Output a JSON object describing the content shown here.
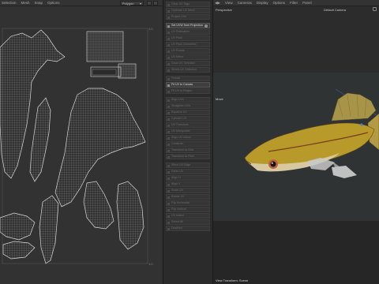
{
  "uv_editor": {
    "menu": [
      "Selection",
      "Mesh",
      "Snap",
      "Options"
    ],
    "mode_select": "Polygon",
    "axis_labels": {
      "top_right": "1.0",
      "bottom_right": "1.0"
    }
  },
  "command_panel": {
    "items": [
      {
        "label": "Clear UV Tags",
        "active": false
      },
      {
        "label": "Optimize UV Mesh",
        "active": false
      },
      {
        "label": "Project UVs",
        "active": false
      },
      {
        "label": "Set UVW from Projection",
        "active": true,
        "dot": true
      },
      {
        "label": "UV Relaxation",
        "active": false
      },
      {
        "label": "UV Pack",
        "active": false
      },
      {
        "label": "UV Pack Geometric",
        "active": false
      },
      {
        "label": "UV Rotate",
        "active": false
      },
      {
        "label": "UV Mirror",
        "active": false
      },
      {
        "label": "Grow UV Selection",
        "active": false
      },
      {
        "label": "Shrink UV Selection",
        "active": false
      },
      {
        "label": "Frontal",
        "active": false
      },
      {
        "label": "Fit UV to Canvas",
        "active": true
      },
      {
        "label": "Fit UV to Region",
        "active": false
      },
      {
        "label": "Align UVs",
        "active": false
      },
      {
        "label": "Straighten UVs",
        "active": false
      },
      {
        "label": "Equalize UV",
        "active": false
      },
      {
        "label": "Cylinder UV",
        "active": false
      },
      {
        "label": "UV Transform",
        "active": false
      },
      {
        "label": "UV Manipulate",
        "active": false
      },
      {
        "label": "Align UV Island",
        "active": false
      },
      {
        "label": "Constrain",
        "active": false
      },
      {
        "label": "Transform to Grid",
        "active": false
      },
      {
        "label": "Transform to Pixel",
        "active": false
      },
      {
        "label": "Stitch UV Edge",
        "active": false
      },
      {
        "label": "Relax UV",
        "active": false
      },
      {
        "label": "Align H",
        "active": false
      },
      {
        "label": "Align V",
        "active": false
      },
      {
        "label": "Scale UV",
        "active": false
      },
      {
        "label": "Rotate UV",
        "active": false
      },
      {
        "label": "Flip Horizontal",
        "active": false
      },
      {
        "label": "Flip Vertical",
        "active": false
      },
      {
        "label": "UV Island",
        "active": false
      },
      {
        "label": "Select All",
        "active": false
      },
      {
        "label": "Deselect",
        "active": false
      }
    ]
  },
  "viewport": {
    "menu": [
      "View",
      "Cameras",
      "Display",
      "Options",
      "Filter",
      "Panel"
    ],
    "projection_label": "Perspective",
    "camera_label": "Default Camera",
    "tool_label": "Move",
    "status_text": "View Transform: Scene",
    "colors": {
      "fish_body": "#b89a2a",
      "fish_belly": "#d8c8a0",
      "fish_fin": "#c8c8c8",
      "fish_stripe": "#7a3a1a"
    }
  }
}
